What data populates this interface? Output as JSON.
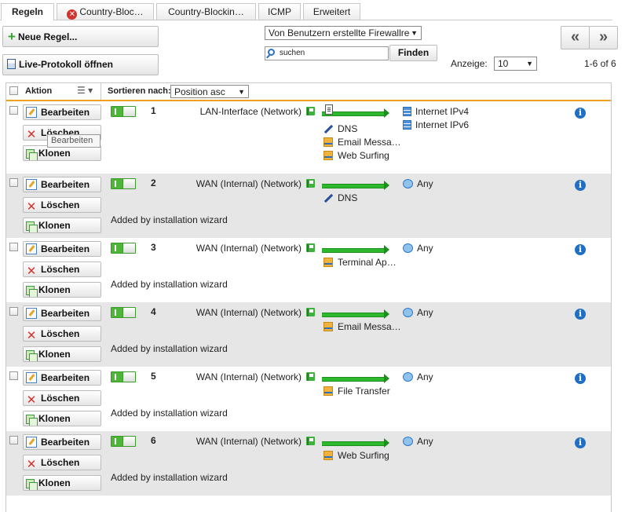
{
  "tabs": [
    {
      "label": "Regeln",
      "active": true
    },
    {
      "label": "Country-Bloc…",
      "icon": "error-icon"
    },
    {
      "label": "Country-Blockin…"
    },
    {
      "label": "ICMP"
    },
    {
      "label": "Erweitert"
    }
  ],
  "toolbar": {
    "new_rule": "Neue Regel...",
    "live_log": "Live-Protokoll öffnen",
    "filter_select": "Von Benutzern erstellte Firewallre",
    "search_placeholder": "suchen",
    "find_button": "Finden",
    "display_label": "Anzeige:",
    "display_value": "10",
    "pager_prev": "«",
    "pager_next": "»",
    "range": "1-6 of 6"
  },
  "header": {
    "action": "Aktion",
    "sort_label": "Sortieren nach:",
    "sort_value": "Position asc"
  },
  "buttons": {
    "edit": "Bearbeiten",
    "delete": "Löschen",
    "clone": "Klonen"
  },
  "tooltip": "Bearbeiten",
  "rules": [
    {
      "num": "1",
      "source": "LAN-Interface (Network)",
      "services": [
        "DNS",
        "Email Messa…",
        "Web Surfing"
      ],
      "service_icons": [
        "dns",
        "folder",
        "folder"
      ],
      "destinations": [
        "Internet IPv4",
        "Internet IPv6"
      ],
      "dest_icon": "server",
      "desc": ""
    },
    {
      "num": "2",
      "source": "WAN (Internal) (Network)",
      "services": [
        "DNS"
      ],
      "service_icons": [
        "dns"
      ],
      "destinations": [
        "Any"
      ],
      "dest_icon": "globe",
      "desc": "Added by installation wizard"
    },
    {
      "num": "3",
      "source": "WAN (Internal) (Network)",
      "services": [
        "Terminal Ap…"
      ],
      "service_icons": [
        "folder"
      ],
      "destinations": [
        "Any"
      ],
      "dest_icon": "globe",
      "desc": "Added by installation wizard"
    },
    {
      "num": "4",
      "source": "WAN (Internal) (Network)",
      "services": [
        "Email Messa…"
      ],
      "service_icons": [
        "folder"
      ],
      "destinations": [
        "Any"
      ],
      "dest_icon": "globe",
      "desc": "Added by installation wizard"
    },
    {
      "num": "5",
      "source": "WAN (Internal) (Network)",
      "services": [
        "File Transfer"
      ],
      "service_icons": [
        "folder"
      ],
      "destinations": [
        "Any"
      ],
      "dest_icon": "globe",
      "desc": "Added by installation wizard"
    },
    {
      "num": "6",
      "source": "WAN (Internal) (Network)",
      "services": [
        "Web Surfing"
      ],
      "service_icons": [
        "folder"
      ],
      "destinations": [
        "Any"
      ],
      "dest_icon": "globe",
      "desc": "Added by installation wizard"
    }
  ],
  "colors": {
    "accent_orange": "#f0a020",
    "toggle_green": "#4fb53a",
    "arrow_green": "#2db82d",
    "info_blue": "#1f6fc4",
    "alt_row": "#e6e6e6"
  }
}
